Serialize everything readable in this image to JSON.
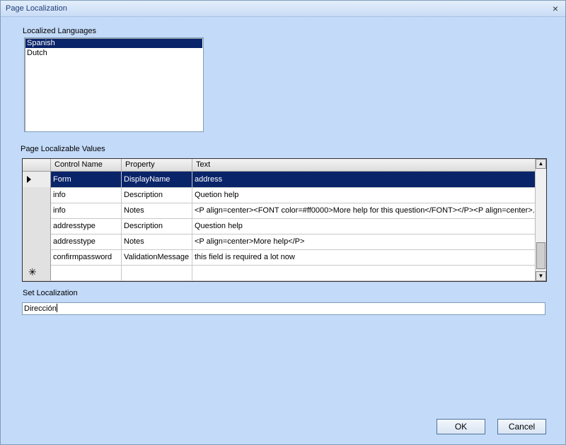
{
  "window": {
    "title": "Page Localization",
    "close_glyph": "×"
  },
  "languages": {
    "label": "Localized Languages",
    "items": [
      {
        "label": "Spanish",
        "selected": true
      },
      {
        "label": "Dutch",
        "selected": false
      }
    ]
  },
  "values_grid": {
    "label": "Page Localizable Values",
    "columns": [
      "Control Name",
      "Property",
      "Text"
    ],
    "rows": [
      [
        "Form",
        "DisplayName",
        "address"
      ],
      [
        "info",
        "Description",
        "Quetion help"
      ],
      [
        "info",
        "Notes",
        "<P align=center><FONT color=#ff0000>More help for this question</FONT></P><P align=center>..."
      ],
      [
        "addresstype",
        "Description",
        "Question help"
      ],
      [
        "addresstype",
        "Notes",
        "<P align=center>More help</P>"
      ],
      [
        "confirmpassword",
        "ValidationMessage",
        "this field is required a lot now"
      ]
    ],
    "new_row_marker": "✳"
  },
  "set_localization": {
    "label": "Set Localization",
    "value": "Dirección"
  },
  "buttons": {
    "ok": "OK",
    "cancel": "Cancel"
  }
}
